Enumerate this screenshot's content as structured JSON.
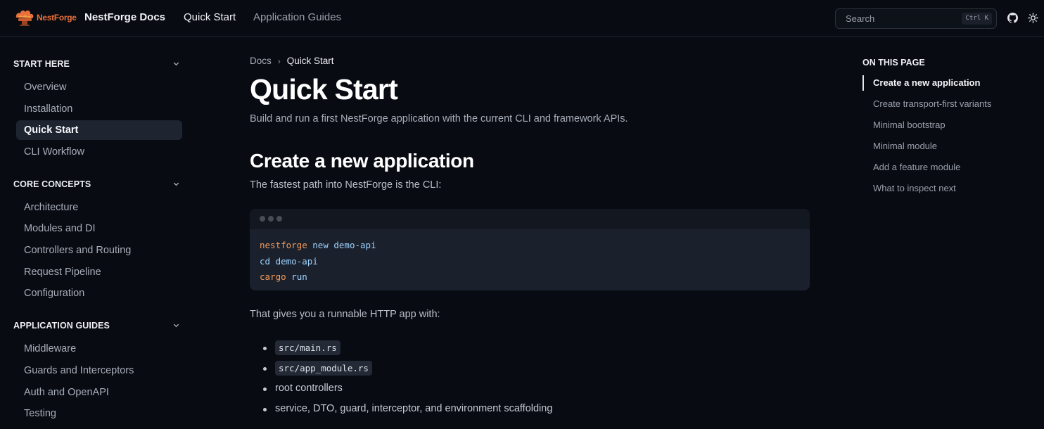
{
  "header": {
    "logo_text": "NestForge",
    "brand": "NestForge Docs",
    "nav": [
      "Quick Start",
      "Application Guides"
    ],
    "search_label": "Search",
    "search_shortcut": "Ctrl K",
    "icons": [
      "github-icon",
      "sun-icon"
    ]
  },
  "sidebar": {
    "sections": [
      {
        "title": "START HERE",
        "items": [
          "Overview",
          "Installation",
          "Quick Start",
          "CLI Workflow"
        ]
      },
      {
        "title": "CORE CONCEPTS",
        "items": [
          "Architecture",
          "Modules and DI",
          "Controllers and Routing",
          "Request Pipeline",
          "Configuration"
        ]
      },
      {
        "title": "APPLICATION GUIDES",
        "items": [
          "Middleware",
          "Guards and Interceptors",
          "Auth and OpenAPI",
          "Testing"
        ]
      }
    ],
    "active_item": "Quick Start"
  },
  "breadcrumb": {
    "root": "Docs",
    "separator": "›",
    "current": "Quick Start"
  },
  "main": {
    "title": "Quick Start",
    "subtitle": "Build and run a first NestForge application with the current CLI and framework APIs.",
    "section_title": "Create a new application",
    "intro": "The fastest path into NestForge is the CLI:",
    "code_lines": [
      {
        "cmd": "nestforge",
        "args": "new demo-api"
      },
      {
        "cmd": "cd",
        "args": "demo-api"
      },
      {
        "cmd": "cargo",
        "args": "run"
      }
    ],
    "after_code": "That gives you a runnable HTTP app with:",
    "list": [
      {
        "code": "src/main.rs"
      },
      {
        "code": "src/app_module.rs"
      },
      {
        "text": "root controllers"
      },
      {
        "text": "service, DTO, guard, interceptor, and environment scaffolding"
      }
    ]
  },
  "toc": {
    "title": "ON THIS PAGE",
    "items": [
      "Create a new application",
      "Create transport-first variants",
      "Minimal bootstrap",
      "Minimal module",
      "Add a feature module",
      "What to inspect next"
    ],
    "active_index": 0
  },
  "colors": {
    "background": "#080b12",
    "accent": "#e8703a",
    "command": "#f49a59",
    "argument": "#9fd2ff"
  }
}
